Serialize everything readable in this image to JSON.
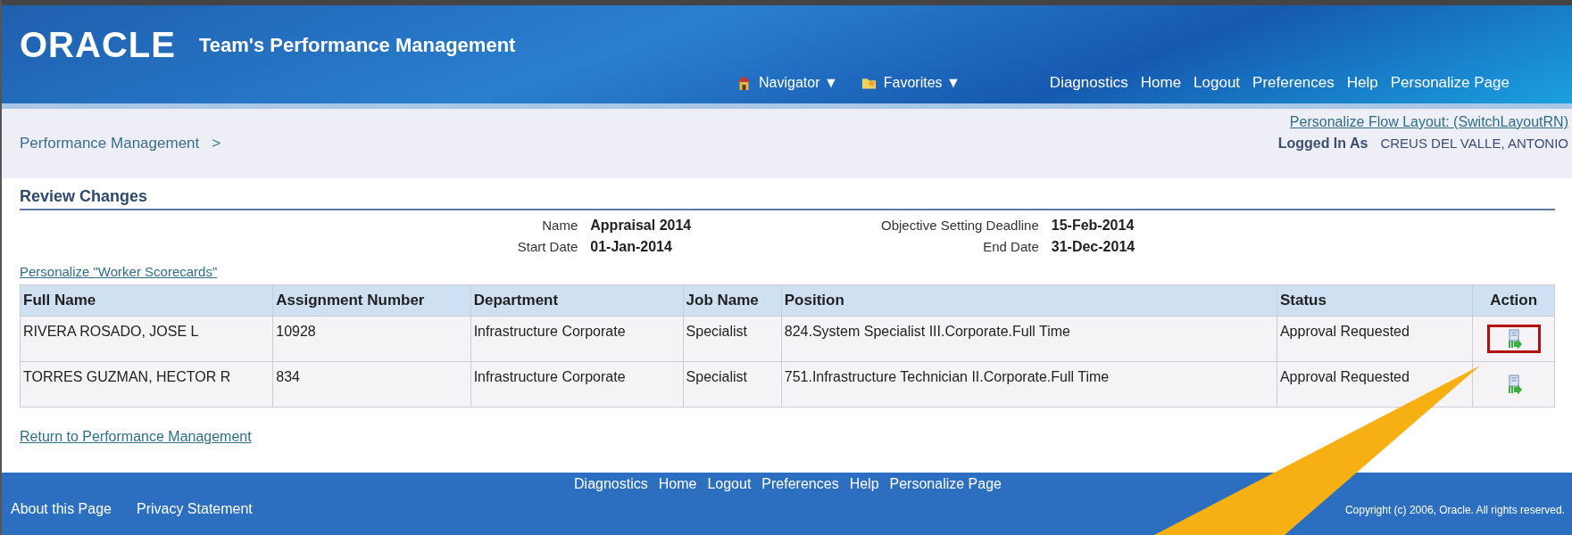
{
  "header": {
    "logo": "ORACLE",
    "title": "Team's Performance Management",
    "menus": [
      {
        "label": "Navigator",
        "kind": "home"
      },
      {
        "label": "Favorites",
        "kind": "favorites"
      }
    ],
    "caret": "▼",
    "links": [
      "Diagnostics",
      "Home",
      "Logout",
      "Preferences",
      "Help",
      "Personalize Page"
    ]
  },
  "breadcrumb": {
    "link": "Performance Management",
    "separator": ">"
  },
  "personalize_flow": "Personalize Flow Layout: (SwitchLayoutRN)",
  "logged_in": {
    "label": "Logged In As",
    "user": "CREUS DEL VALLE, ANTONIO"
  },
  "section_title": "Review Changes",
  "details_left": [
    {
      "label": "Name",
      "value": "Appraisal 2014"
    },
    {
      "label": "Start Date",
      "value": "01-Jan-2014"
    }
  ],
  "details_right": [
    {
      "label": "Objective Setting Deadline",
      "value": "15-Feb-2014"
    },
    {
      "label": "End Date",
      "value": "31-Dec-2014"
    }
  ],
  "personalize_table": "Personalize \"Worker Scorecards\"",
  "table": {
    "columns": [
      "Full Name",
      "Assignment Number",
      "Department",
      "Job Name",
      "Position",
      "Status",
      "Action"
    ],
    "rows": [
      {
        "cells": [
          "RIVERA ROSADO, JOSE L",
          "10928",
          "Infrastructure Corporate",
          "Specialist",
          "824.System Specialist III.Corporate.Full Time",
          "Approval Requested"
        ],
        "highlighted": true
      },
      {
        "cells": [
          "TORRES GUZMAN, HECTOR R",
          "834",
          "Infrastructure Corporate",
          "Specialist",
          "751.Infrastructure Technician II.Corporate.Full Time",
          "Approval Requested"
        ],
        "highlighted": false
      }
    ]
  },
  "return_link": "Return to Performance Management",
  "footer": {
    "links": [
      "Diagnostics",
      "Home",
      "Logout",
      "Preferences",
      "Help",
      "Personalize Page"
    ],
    "left_links": [
      "About this Page",
      "Privacy Statement"
    ],
    "copyright": "Copyright (c) 2006, Oracle. All rights reserved."
  }
}
